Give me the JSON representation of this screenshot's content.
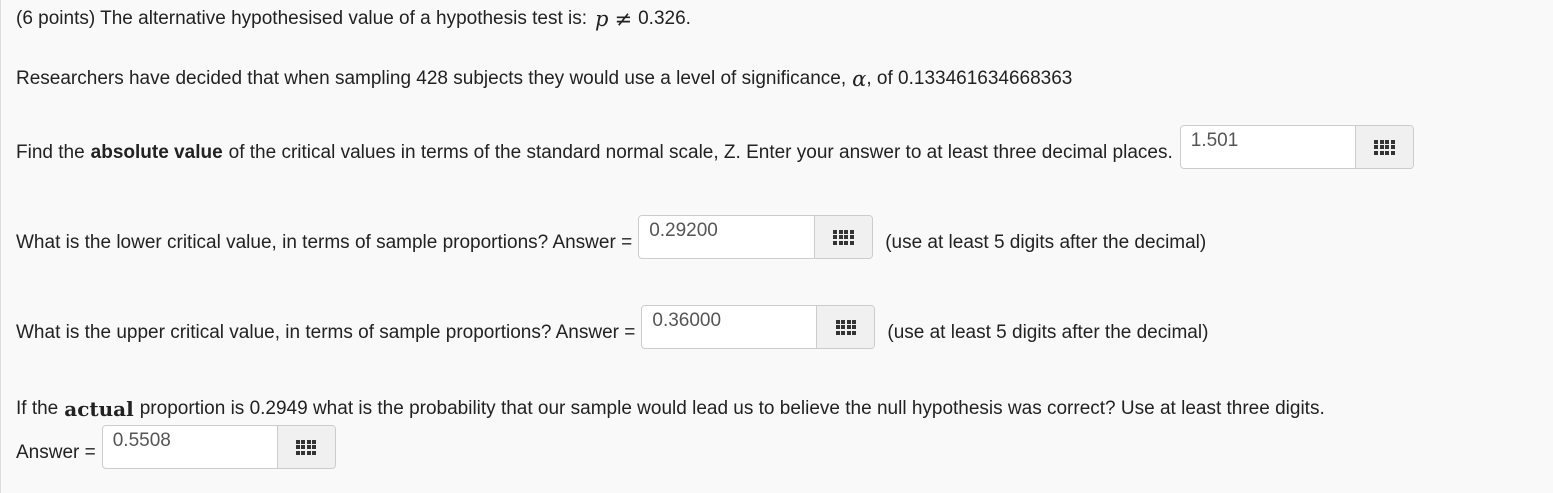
{
  "intro": {
    "prefix": "(6 points) The alternative hypothesised value of a hypothesis test is:",
    "variable": "p",
    "operator": "≠",
    "value": "0.326."
  },
  "researchers": {
    "text": "Researchers have decided that when sampling 428 subjects they would use a level of significance,",
    "alpha_symbol": "α",
    "suffix": ", of 0.133461634668363"
  },
  "q1": {
    "pre": "Find the",
    "bold": "absolute value",
    "post": "of the critical values in terms of the standard normal scale, Z. Enter your answer to at least three decimal places.",
    "value": "1.501"
  },
  "q2": {
    "label": "What is the lower critical value, in terms of sample proportions? Answer =",
    "value": "0.29200",
    "note": "(use at least 5 digits after the decimal)"
  },
  "q3": {
    "label": "What is the upper critical value, in terms of sample proportions? Answer =",
    "value": "0.36000",
    "note": "(use at least 5 digits after the decimal)"
  },
  "q4": {
    "pre": "If the",
    "bold": "actual",
    "post": "proportion is 0.2949 what is the probability that our sample would lead us to believe the null hypothesis was correct? Use at least three digits.",
    "label": "Answer =",
    "value": "0.5508"
  },
  "icons": {
    "keypad": "keypad-grid-icon"
  }
}
